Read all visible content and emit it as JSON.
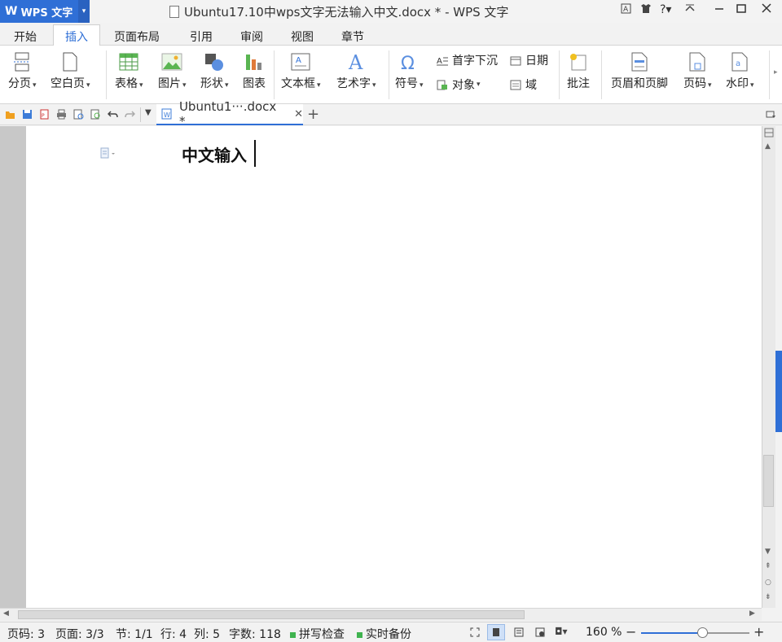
{
  "app": {
    "name": "WPS 文字",
    "logo": "W"
  },
  "window": {
    "title": "Ubuntu17.10中wps文字无法输入中文.docx * - WPS 文字"
  },
  "menu_tabs": [
    "开始",
    "插入",
    "页面布局",
    "引用",
    "审阅",
    "视图",
    "章节"
  ],
  "active_tab": "插入",
  "ribbon": {
    "page_break": "分页",
    "blank_page": "空白页",
    "table": "表格",
    "picture": "图片",
    "shapes": "形状",
    "chart": "图表",
    "textbox": "文本框",
    "wordart": "艺术字",
    "symbol": "符号",
    "drop_cap": "首字下沉",
    "object": "对象",
    "date": "日期",
    "field": "域",
    "comment": "批注",
    "header_footer": "页眉和页脚",
    "page_number": "页码",
    "watermark": "水印"
  },
  "doc_tab": {
    "label": "Ubuntu1···.docx *"
  },
  "document": {
    "text": "中文输入"
  },
  "status": {
    "page_num": "页码: 3",
    "pages": "页面: 3/3",
    "section": "节: 1/1",
    "row": "行: 4",
    "col": "列: 5",
    "words": "字数: 118",
    "spell_check": "拼写检查",
    "backup": "实时备份",
    "zoom": "160 %"
  },
  "colors": {
    "accent": "#2f6fd6",
    "status_green": "#3fb34f"
  }
}
